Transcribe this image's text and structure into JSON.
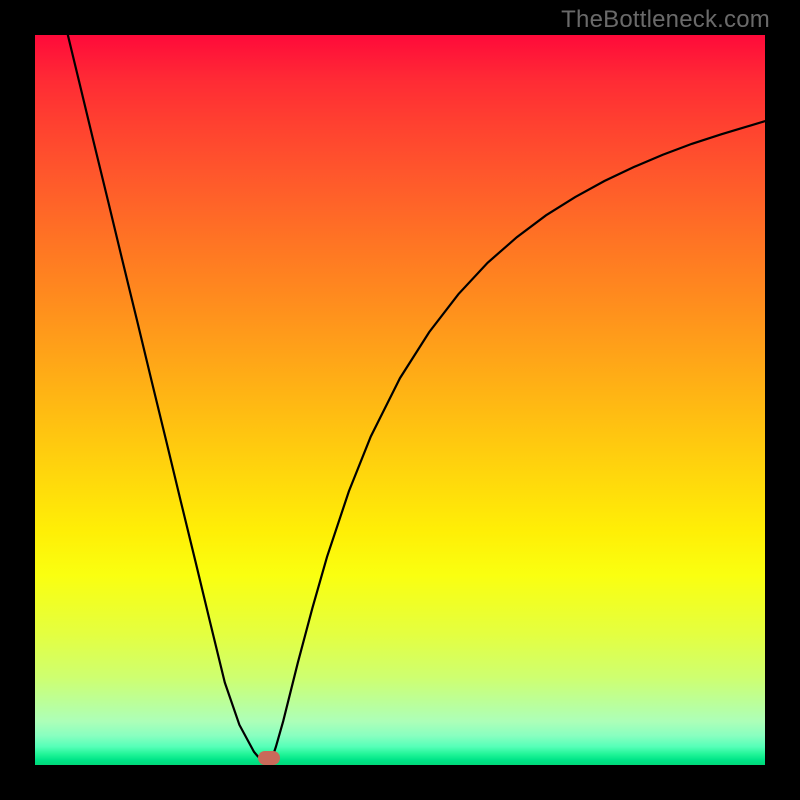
{
  "attribution": "TheBottleneck.com",
  "colors": {
    "frame": "#000000",
    "marker": "#c96a5a",
    "curve": "#000000",
    "gradient_top": "#ff0a3a",
    "gradient_bottom": "#00d878"
  },
  "chart_data": {
    "type": "line",
    "title": "",
    "xlabel": "",
    "ylabel": "",
    "xlim": [
      0,
      1
    ],
    "ylim": [
      0,
      1
    ],
    "series": [
      {
        "name": "bottleneck-curve-left",
        "x": [
          0.045,
          0.06,
          0.08,
          0.1,
          0.12,
          0.14,
          0.16,
          0.18,
          0.2,
          0.22,
          0.24,
          0.26,
          0.28,
          0.3,
          0.305,
          0.31,
          0.315,
          0.32
        ],
        "y": [
          1.0,
          0.938,
          0.855,
          0.773,
          0.69,
          0.608,
          0.525,
          0.443,
          0.36,
          0.278,
          0.195,
          0.113,
          0.055,
          0.018,
          0.012,
          0.008,
          0.005,
          0.003
        ]
      },
      {
        "name": "bottleneck-curve-right",
        "x": [
          0.32,
          0.325,
          0.33,
          0.34,
          0.36,
          0.38,
          0.4,
          0.43,
          0.46,
          0.5,
          0.54,
          0.58,
          0.62,
          0.66,
          0.7,
          0.74,
          0.78,
          0.82,
          0.86,
          0.9,
          0.94,
          0.98,
          1.0
        ],
        "y": [
          0.003,
          0.01,
          0.025,
          0.06,
          0.14,
          0.215,
          0.285,
          0.375,
          0.45,
          0.53,
          0.593,
          0.645,
          0.688,
          0.723,
          0.753,
          0.778,
          0.8,
          0.819,
          0.836,
          0.851,
          0.864,
          0.876,
          0.882
        ]
      }
    ],
    "marker": {
      "x": 0.32,
      "y": 0.01
    },
    "annotations": []
  }
}
